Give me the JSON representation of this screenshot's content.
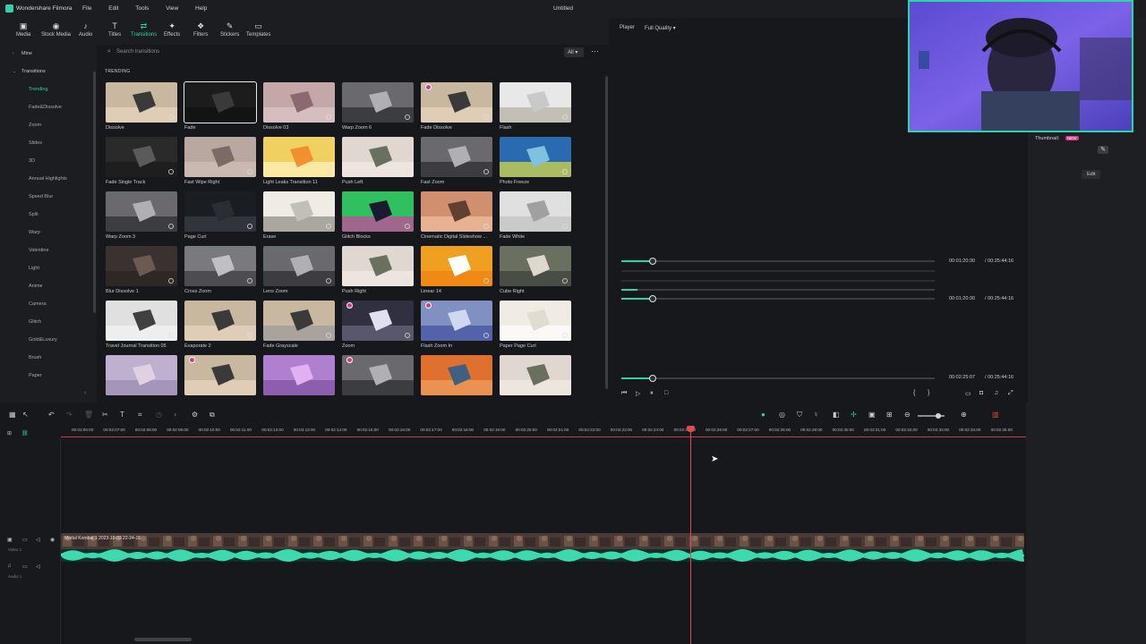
{
  "titlebar": {
    "app_name": "Wondershare Filmora",
    "menu": [
      "File",
      "Edit",
      "Tools",
      "View",
      "Help"
    ],
    "document_title": "Untitled"
  },
  "toolbar": {
    "tabs": [
      {
        "label": "Media",
        "icon": "media-icon"
      },
      {
        "label": "Stock Media",
        "icon": "stock-media-icon"
      },
      {
        "label": "Audio",
        "icon": "audio-icon"
      },
      {
        "label": "Titles",
        "icon": "titles-icon"
      },
      {
        "label": "Transitions",
        "icon": "transitions-icon",
        "active": true
      },
      {
        "label": "Effects",
        "icon": "effects-icon"
      },
      {
        "label": "Filters",
        "icon": "filters-icon"
      },
      {
        "label": "Stickers",
        "icon": "stickers-icon"
      },
      {
        "label": "Templates",
        "icon": "templates-icon"
      }
    ]
  },
  "sidebar": {
    "mine": "Mine",
    "transitions": "Transitions",
    "items": [
      "Trending",
      "Fade&Dissolve",
      "Zoom",
      "Slides",
      "3D",
      "Annual Highlights",
      "Speed Blur",
      "Split",
      "Warp",
      "Valentine",
      "Light",
      "Anime",
      "Camera",
      "Glitch",
      "Gold&Luxury",
      "Brush",
      "Paper"
    ]
  },
  "search": {
    "placeholder": "Search transitions",
    "filter": "All"
  },
  "section_title": "TRENDING",
  "transitions": [
    "Dissolve",
    "Fade",
    "Dissolve 03",
    "Warp Zoom 6",
    "Fade Dissolve",
    "Flash",
    "Fade Single Track",
    "Fast Wipe Right",
    "Light Leaks Transition 11",
    "Push Left",
    "Fast Zoom",
    "Photo Freeze",
    "Warp Zoom 3",
    "Page Curl",
    "Erase",
    "Glitch Blocks",
    "Cinematic Digital Slideshow ...",
    "Fade White",
    "Blur Dissolve 1",
    "Cross Zoom",
    "Lens Zoom",
    "Push Right",
    "Linear 14",
    "Cube Right",
    "Travel Journal Transition 05",
    "Evaporate 2",
    "Fade Grayscale",
    "Zoom",
    "Flash Zoom In",
    "Paper Page Curl",
    "",
    "",
    "",
    "",
    "",
    ""
  ],
  "player": {
    "label": "Player",
    "quality": "Full Quality",
    "current_time": "00:01:20:30",
    "total_time": "00:25:44:16",
    "main_time": "00:02:25:07",
    "main_total": "00:25:44:16",
    "current_fraction": 0.1,
    "main_fraction": 0.1
  },
  "props": {
    "thumbnail": "Thumbnail:",
    "new": "NEW",
    "edit": "Edit"
  },
  "timeline": {
    "ticks": [
      "00:02:06:00",
      "00:02:07:00",
      "00:02:08:00",
      "00:02:09:00",
      "00:02:10:00",
      "00:02:11:00",
      "00:02:12:00",
      "00:02:13:00",
      "00:02:14:00",
      "00:02:15:00",
      "00:02:16:00",
      "00:02:17:00",
      "00:02:18:00",
      "00:02:19:00",
      "00:02:20:00",
      "00:02:21:00",
      "00:02:22:00",
      "00:02:23:00",
      "00:02:24:00",
      "00:02:25:00",
      "00:02:26:00",
      "00:02:27:00",
      "00:02:28:00",
      "00:02:29:00",
      "00:02:30:00",
      "00:02:31:00",
      "00:02:32:00",
      "00:02:33:00",
      "00:02:34:00",
      "00:02:35:00"
    ],
    "clip_name": "Mortal Kombat 1 2023-10-03 22-24-16",
    "video_track": "Video 1",
    "audio_track": "Audio 1"
  }
}
